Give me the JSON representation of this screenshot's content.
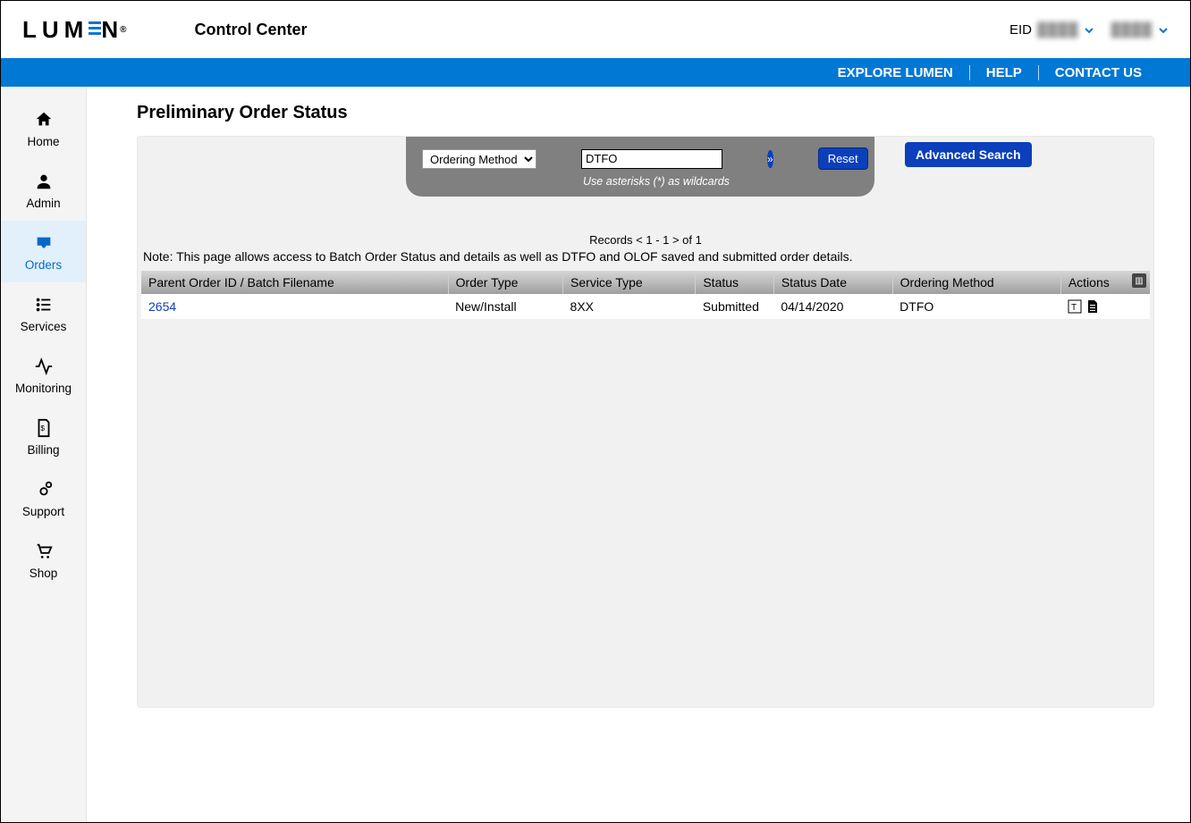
{
  "header": {
    "app_title": "Control Center",
    "eid_label": "EID",
    "eid_value": "████",
    "username": "████"
  },
  "nav": {
    "explore": "EXPLORE LUMEN",
    "help": "HELP",
    "contact": "CONTACT US"
  },
  "sidebar": {
    "items": [
      {
        "label": "Home"
      },
      {
        "label": "Admin"
      },
      {
        "label": "Orders"
      },
      {
        "label": "Services"
      },
      {
        "label": "Monitoring"
      },
      {
        "label": "Billing"
      },
      {
        "label": "Support"
      },
      {
        "label": "Shop"
      }
    ]
  },
  "page": {
    "title": "Preliminary Order Status",
    "filter": {
      "select_label": "Ordering Method",
      "search_value": "DTFO",
      "hint": "Use asterisks (*) as wildcards",
      "reset": "Reset",
      "advanced": "Advanced Search"
    },
    "records_text": "Records < 1 - 1 >   of   1",
    "note": "Note: This page allows access to Batch Order Status and details as well as DTFO and OLOF saved and submitted order details.",
    "table": {
      "headers": {
        "parent": "Parent Order ID / Batch Filename",
        "order_type": "Order Type",
        "service_type": "Service Type",
        "status": "Status",
        "status_date": "Status Date",
        "ordering_method": "Ordering Method",
        "actions": "Actions"
      },
      "rows": [
        {
          "parent": "2654",
          "order_type": "New/Install",
          "service_type": "8XX",
          "status": "Submitted",
          "status_date": "04/14/2020",
          "ordering_method": "DTFO"
        }
      ]
    }
  }
}
